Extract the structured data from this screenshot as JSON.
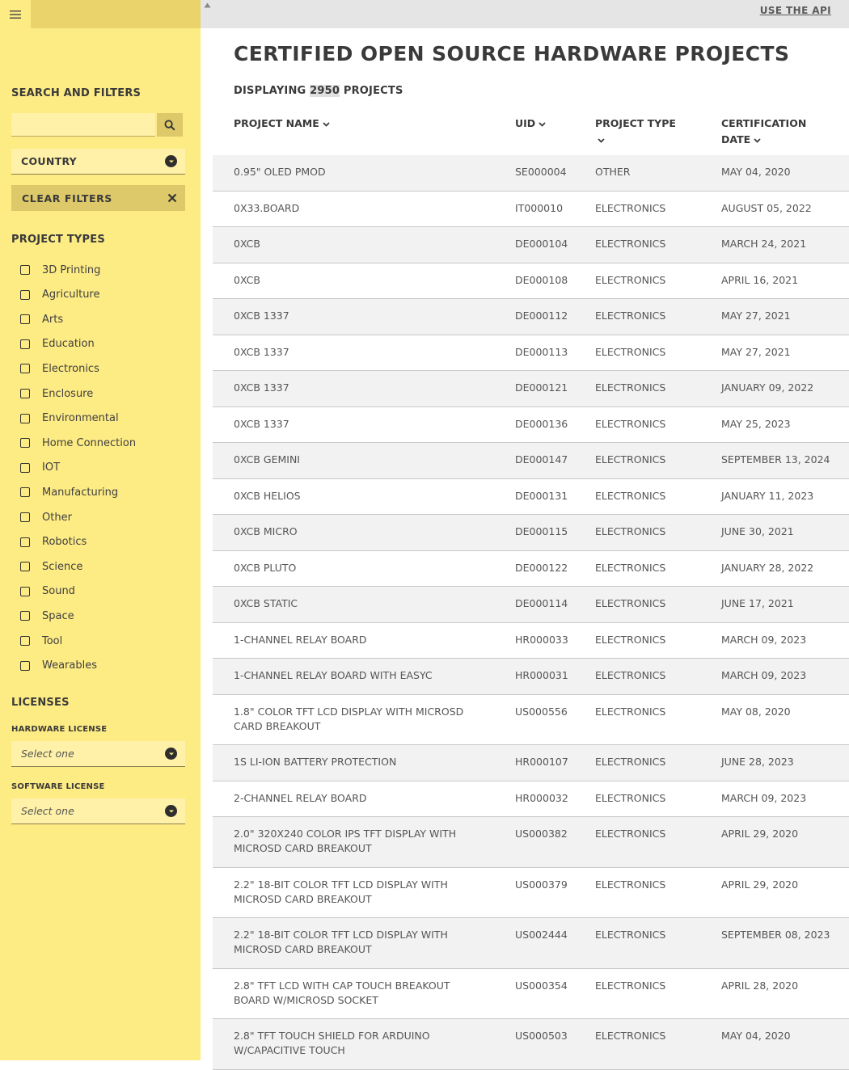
{
  "header": {
    "use_api": "USE THE API",
    "title": "CERTIFIED OPEN SOURCE HARDWARE PROJECTS",
    "displaying_prefix": "DISPLAYING ",
    "displaying_count": "2950",
    "displaying_suffix": " PROJECTS"
  },
  "sidebar": {
    "search_heading": "SEARCH AND FILTERS",
    "search_value": "",
    "country_label": "COUNTRY",
    "clear_filters": "CLEAR FILTERS",
    "project_types_heading": "PROJECT TYPES",
    "project_types": [
      "3D Printing",
      "Agriculture",
      "Arts",
      "Education",
      "Electronics",
      "Enclosure",
      "Environmental",
      "Home Connection",
      "IOT",
      "Manufacturing",
      "Other",
      "Robotics",
      "Science",
      "Sound",
      "Space",
      "Tool",
      "Wearables"
    ],
    "licenses_heading": "LICENSES",
    "hardware_license_label": "HARDWARE LICENSE",
    "hardware_license_value": "Select one",
    "software_license_label": "SOFTWARE LICENSE",
    "software_license_value": "Select one"
  },
  "table": {
    "columns": {
      "name": "PROJECT NAME",
      "uid": "UID",
      "type": "PROJECT TYPE",
      "date_line1": "CERTIFICATION",
      "date_line2": "DATE"
    },
    "rows": [
      {
        "name": "0.95\" OLED PMOD",
        "uid": "SE000004",
        "type": "OTHER",
        "date": "MAY 04, 2020"
      },
      {
        "name": "0X33.BOARD",
        "uid": "IT000010",
        "type": "ELECTRONICS",
        "date": "AUGUST 05, 2022"
      },
      {
        "name": "0XCB",
        "uid": "DE000104",
        "type": "ELECTRONICS",
        "date": "MARCH 24, 2021"
      },
      {
        "name": "0XCB",
        "uid": "DE000108",
        "type": "ELECTRONICS",
        "date": "APRIL 16, 2021"
      },
      {
        "name": "0XCB 1337",
        "uid": "DE000112",
        "type": "ELECTRONICS",
        "date": "MAY 27, 2021"
      },
      {
        "name": "0XCB 1337",
        "uid": "DE000113",
        "type": "ELECTRONICS",
        "date": "MAY 27, 2021"
      },
      {
        "name": "0XCB 1337",
        "uid": "DE000121",
        "type": "ELECTRONICS",
        "date": "JANUARY 09, 2022"
      },
      {
        "name": "0XCB 1337",
        "uid": "DE000136",
        "type": "ELECTRONICS",
        "date": "MAY 25, 2023"
      },
      {
        "name": "0XCB GEMINI",
        "uid": "DE000147",
        "type": "ELECTRONICS",
        "date": "SEPTEMBER 13, 2024"
      },
      {
        "name": "0XCB HELIOS",
        "uid": "DE000131",
        "type": "ELECTRONICS",
        "date": "JANUARY 11, 2023"
      },
      {
        "name": "0XCB MICRO",
        "uid": "DE000115",
        "type": "ELECTRONICS",
        "date": "JUNE 30, 2021"
      },
      {
        "name": "0XCB PLUTO",
        "uid": "DE000122",
        "type": "ELECTRONICS",
        "date": "JANUARY 28, 2022"
      },
      {
        "name": "0XCB STATIC",
        "uid": "DE000114",
        "type": "ELECTRONICS",
        "date": "JUNE 17, 2021"
      },
      {
        "name": "1-CHANNEL RELAY BOARD",
        "uid": "HR000033",
        "type": "ELECTRONICS",
        "date": "MARCH 09, 2023"
      },
      {
        "name": "1-CHANNEL RELAY BOARD WITH EASYC",
        "uid": "HR000031",
        "type": "ELECTRONICS",
        "date": "MARCH 09, 2023"
      },
      {
        "name": "1.8\" COLOR TFT LCD DISPLAY WITH MICROSD CARD BREAKOUT",
        "uid": "US000556",
        "type": "ELECTRONICS",
        "date": "MAY 08, 2020"
      },
      {
        "name": "1S LI-ION BATTERY PROTECTION",
        "uid": "HR000107",
        "type": "ELECTRONICS",
        "date": "JUNE 28, 2023"
      },
      {
        "name": "2-CHANNEL RELAY BOARD",
        "uid": "HR000032",
        "type": "ELECTRONICS",
        "date": "MARCH 09, 2023"
      },
      {
        "name": "2.0\" 320X240 COLOR IPS TFT DISPLAY WITH MICROSD CARD BREAKOUT",
        "uid": "US000382",
        "type": "ELECTRONICS",
        "date": "APRIL 29, 2020"
      },
      {
        "name": "2.2\" 18-BIT COLOR TFT LCD DISPLAY WITH MICROSD CARD BREAKOUT",
        "uid": "US000379",
        "type": "ELECTRONICS",
        "date": "APRIL 29, 2020"
      },
      {
        "name": "2.2\" 18-BIT COLOR TFT LCD DISPLAY WITH MICROSD CARD BREAKOUT",
        "uid": "US002444",
        "type": "ELECTRONICS",
        "date": "SEPTEMBER 08, 2023"
      },
      {
        "name": "2.8\" TFT LCD WITH CAP TOUCH BREAKOUT BOARD W/MICROSD SOCKET",
        "uid": "US000354",
        "type": "ELECTRONICS",
        "date": "APRIL 28, 2020"
      },
      {
        "name": "2.8\" TFT TOUCH SHIELD FOR ARDUINO W/CAPACITIVE TOUCH",
        "uid": "US000503",
        "type": "ELECTRONICS",
        "date": "MAY 04, 2020"
      }
    ]
  },
  "colors": {
    "sidebar_bg": "#fdeb84",
    "field_bg": "#fff1a8",
    "accent_dark": "#ddc86a",
    "row_alt": "#f2f2f2",
    "topbar": "#e5e5e5"
  },
  "icons": [
    "hamburger-menu-icon",
    "search-icon",
    "chevron-down-icon",
    "close-icon",
    "scroll-up-arrow-icon"
  ]
}
